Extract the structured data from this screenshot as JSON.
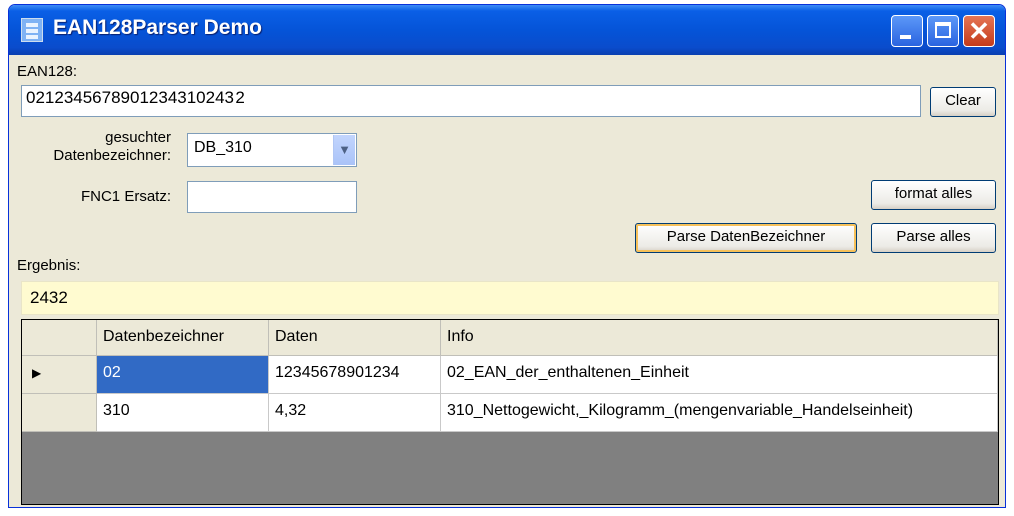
{
  "window": {
    "title": "EAN128Parser Demo"
  },
  "icons": {
    "app": "app-icon",
    "minimize": "minimize-icon",
    "maximize": "maximize-icon",
    "close": "close-icon",
    "dropdown": "chevron-down-icon",
    "row_indicator": "row-pointer-icon"
  },
  "colors": {
    "titlebar": "#0554d8",
    "result_background": "#fffbd0",
    "selection": "#316ac5",
    "grid_background": "#808080"
  },
  "ean": {
    "label": "EAN128:",
    "value": "0212345678901234310243 2",
    "clear_button": "Clear"
  },
  "search": {
    "label_line1": "gesuchter",
    "label_line2": "Datenbezeichner:",
    "selected": "DB_310"
  },
  "fnc1": {
    "label": "FNC1 Ersatz:",
    "value": ""
  },
  "buttons": {
    "format_all": "format alles",
    "parse_identifier": "Parse DatenBezeichner",
    "parse_all": "Parse alles"
  },
  "result": {
    "label": "Ergebnis:",
    "value": "2432"
  },
  "table": {
    "columns": [
      "Datenbezeichner",
      "Daten",
      "Info"
    ],
    "rows": [
      {
        "id": "02",
        "data": "12345678901234",
        "info": "02_EAN_der_enthaltenen_Einheit"
      },
      {
        "id": "310",
        "data": "4,32",
        "info": "310_Nettogewicht,_Kilogramm_(mengenvariable_Handelseinheit)"
      }
    ]
  }
}
